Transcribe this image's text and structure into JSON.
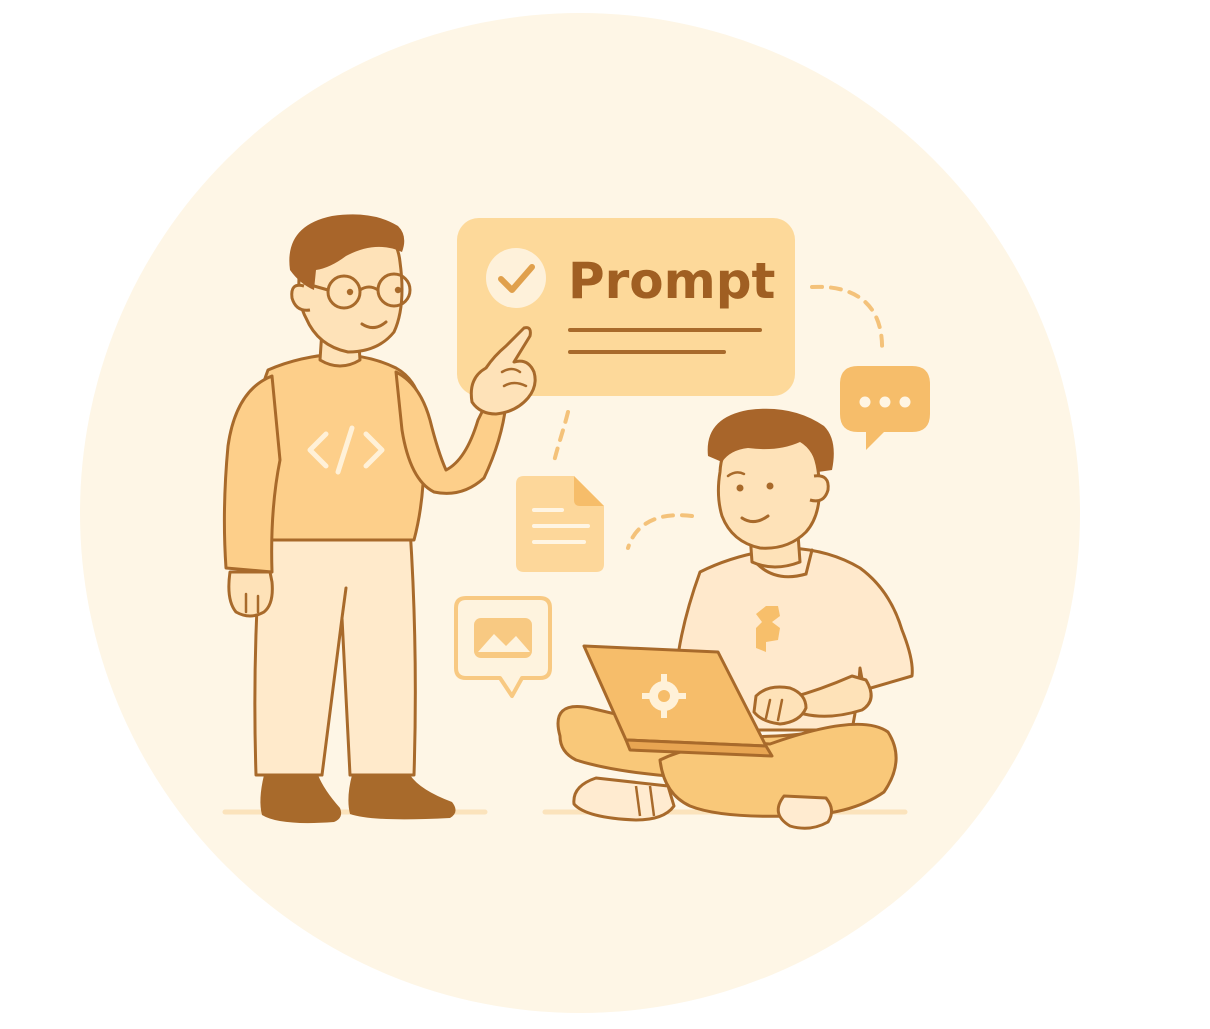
{
  "card": {
    "title": "Prompt"
  },
  "icons": {
    "check": "check-circle-icon",
    "chat": "chat-bubble-icon",
    "document": "document-icon",
    "image": "image-message-icon",
    "code": "code-icon",
    "gear": "gear-icon"
  },
  "colors": {
    "background_circle": "#FEF6E6",
    "card": "#FDD99A",
    "outline": "#A86A2B",
    "accent": "#F6BD6A",
    "light": "#FEE8C4",
    "hair": "#A8652A"
  }
}
